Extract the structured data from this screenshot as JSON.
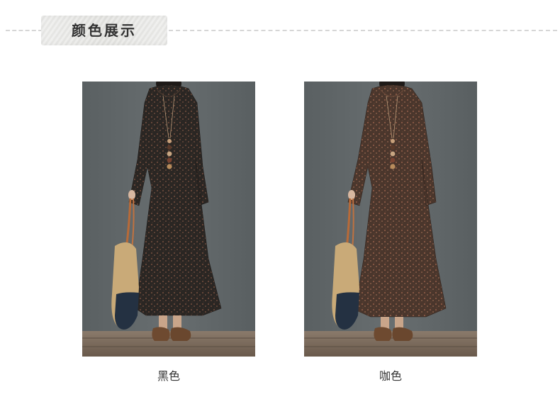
{
  "header": {
    "title": "颜色展示"
  },
  "products": [
    {
      "color_label": "黑色",
      "dress_color": "#2a2623",
      "print_color": "#6b4a3a"
    },
    {
      "color_label": "咖色",
      "dress_color": "#4a362c",
      "print_color": "#8a5a45"
    }
  ],
  "colors": {
    "background": "#ffffff",
    "wall": "#5e6466",
    "floor": "#7a6a5c",
    "title_bg": "#e6e6e3"
  }
}
